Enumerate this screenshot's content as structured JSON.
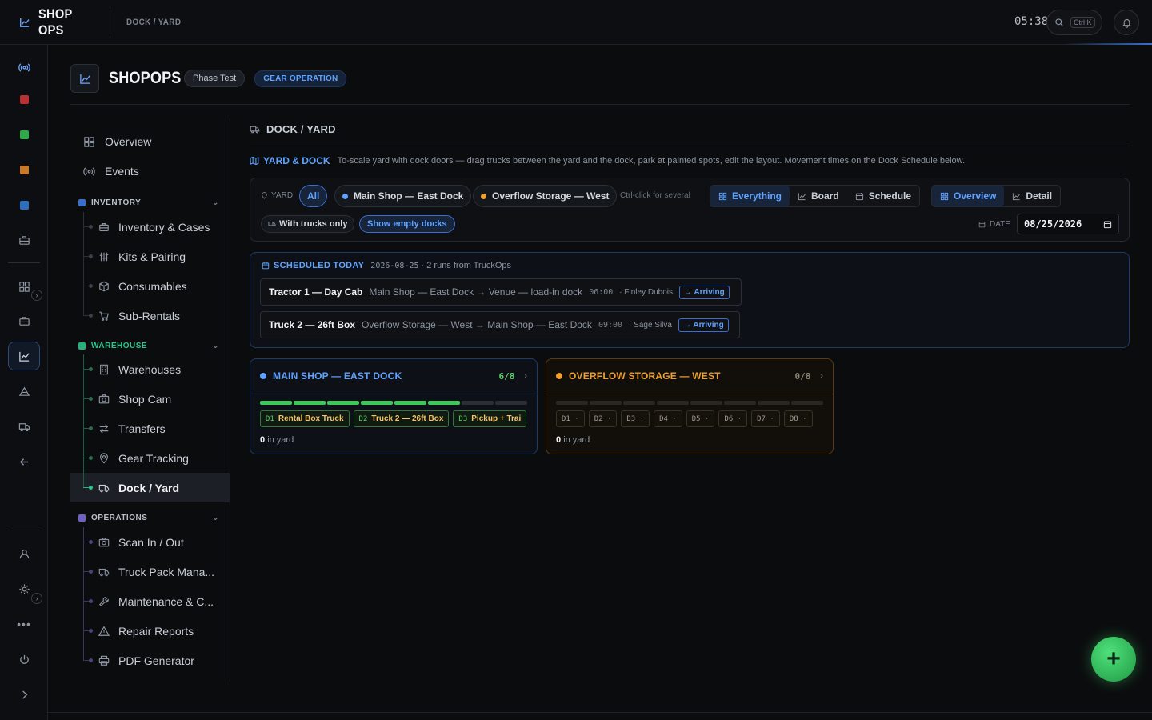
{
  "app": {
    "brand": "SHOP OPS",
    "breadcrumb": "DOCK / YARD",
    "clock": "05:38",
    "search_kbd": "Ctrl K"
  },
  "colors": {
    "accent": "#5fa3ff",
    "green": "#3ec65a",
    "orange": "#f0a030",
    "bg": "#0b0c0e"
  },
  "header": {
    "title": "SHOPOPS",
    "phase_chip": "Phase Test",
    "mode_chip": "GEAR OPERATION"
  },
  "nav": {
    "overview": "Overview",
    "events": "Events",
    "sections": [
      {
        "title": "INVENTORY",
        "color": "#3a6fd0",
        "items": [
          "Inventory & Cases",
          "Kits & Pairing",
          "Consumables",
          "Sub-Rentals"
        ]
      },
      {
        "title": "WAREHOUSE",
        "color": "#26b07a",
        "items": [
          "Warehouses",
          "Shop Cam",
          "Transfers",
          "Gear Tracking",
          "Dock / Yard"
        ]
      },
      {
        "title": "OPERATIONS",
        "color": "#7b6fd0",
        "items": [
          "Scan In / Out",
          "Truck Pack Mana...",
          "Maintenance & C...",
          "Repair Reports",
          "PDF Generator"
        ]
      }
    ]
  },
  "content": {
    "section_title": "DOCK / YARD",
    "intro_tag": "YARD & DOCK",
    "intro_text": "To-scale yard with dock doors — drag trucks between the yard and the dock, park at painted spots, edit the layout. Movement times on the Dock Schedule below.",
    "filters": {
      "yard_label": "YARD",
      "all": "All",
      "yards": [
        "Main Shop — East Dock",
        "Overflow Storage — West"
      ],
      "hint": "Ctrl-click for several",
      "view_modes": [
        "Everything",
        "Board",
        "Schedule"
      ],
      "detail_modes": [
        "Overview",
        "Detail"
      ],
      "with_trucks": "With trucks only",
      "show_empty": "Show empty docks",
      "date_label": "DATE",
      "date_value": "08/25/2026"
    },
    "schedule": {
      "title": "SCHEDULED TODAY",
      "date": "2026-08-25",
      "summary": "· 2 runs from TruckOps",
      "runs": [
        {
          "name": "Tractor 1 — Day Cab",
          "route": "Main Shop — East Dock → Venue — load-in dock",
          "time": "06:00",
          "person": "· Finley Dubois",
          "status": "→ Arriving"
        },
        {
          "name": "Truck 2 — 26ft Box",
          "route": "Overflow Storage — West → Main Shop — East Dock",
          "time": "09:00",
          "person": "· Sage Silva",
          "status": "→ Arriving"
        }
      ]
    },
    "yards": [
      {
        "name": "MAIN SHOP — EAST DOCK",
        "count": "6/8",
        "filled": 6,
        "total": 8,
        "doors": [
          {
            "id": "D1",
            "label": "Rental Box Truck"
          },
          {
            "id": "D2",
            "label": "Truck 2 — 26ft Box"
          },
          {
            "id": "D3",
            "label": "Pickup + Trai"
          }
        ],
        "in_yard_count": "0",
        "in_yard_label": "in yard"
      },
      {
        "name": "OVERFLOW STORAGE — WEST",
        "count": "0/8",
        "filled": 0,
        "total": 8,
        "doors": [
          {
            "id": "D1",
            "label": "·"
          },
          {
            "id": "D2",
            "label": "·"
          },
          {
            "id": "D3",
            "label": "·"
          },
          {
            "id": "D4",
            "label": "·"
          },
          {
            "id": "D5",
            "label": "·"
          },
          {
            "id": "D6",
            "label": "·"
          },
          {
            "id": "D7",
            "label": "·"
          },
          {
            "id": "D8",
            "label": "·"
          }
        ],
        "in_yard_count": "0",
        "in_yard_label": "in yard"
      }
    ]
  },
  "fab": {
    "label": "+"
  }
}
